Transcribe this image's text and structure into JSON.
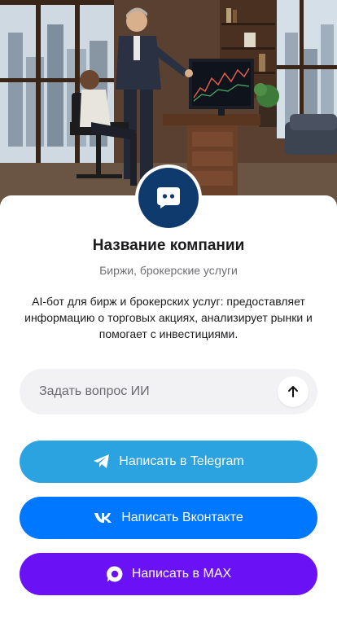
{
  "company": {
    "name": "Название компании",
    "category": "Биржи, брокерские услуги",
    "description": "AI-бот для бирж и брокерских услуг: предоставляет информацию о торговых акциях, анализирует рынки и помогает с инвестициями."
  },
  "ask": {
    "placeholder": "Задать вопрос ИИ",
    "send_icon": "arrow-up-icon"
  },
  "buttons": {
    "telegram": {
      "label": "Написать в Telegram",
      "icon": "telegram-icon",
      "color": "#2aa3e0"
    },
    "vk": {
      "label": "Написать Вконтакте",
      "icon": "vk-icon",
      "color": "#0077ff"
    },
    "max": {
      "label": "Написать в MAX",
      "icon": "max-icon",
      "color": "#6a12f5"
    }
  },
  "colors": {
    "avatar_bg": "#0f3a6e",
    "text_primary": "#1c1c1e",
    "text_secondary": "#6e6e73",
    "input_bg": "#f2f2f4"
  }
}
